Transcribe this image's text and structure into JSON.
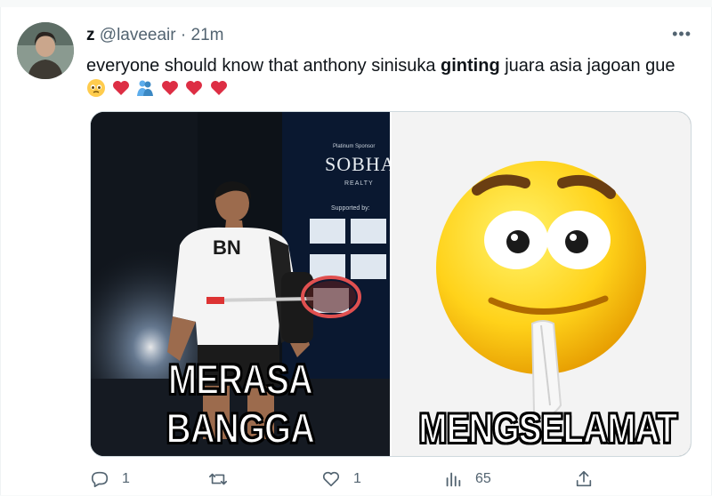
{
  "tweet": {
    "display_name": "z",
    "handle": "@laveeair",
    "separator": "·",
    "time": "21m",
    "text_part1": "everyone should know that anthony sinisuka ",
    "text_bold": "ginting",
    "text_part2": " juara asia jagoan gue"
  },
  "media": {
    "left_caption": "MERASA BANGGA",
    "right_caption": "MENGSELAMAT",
    "left_sponsor_title": "SOBHA",
    "left_sponsor_sub": "REALTY",
    "left_sponsor_platinum": "Platinum Sponsor",
    "left_sponsor_supported": "Supported by:",
    "shirt_text": "BN"
  },
  "actions": {
    "reply_count": "1",
    "retweet_count": "",
    "like_count": "1",
    "views_count": "65"
  },
  "colors": {
    "accent": "#1d9bf0",
    "muted": "#536471",
    "heart": "#f91880"
  }
}
